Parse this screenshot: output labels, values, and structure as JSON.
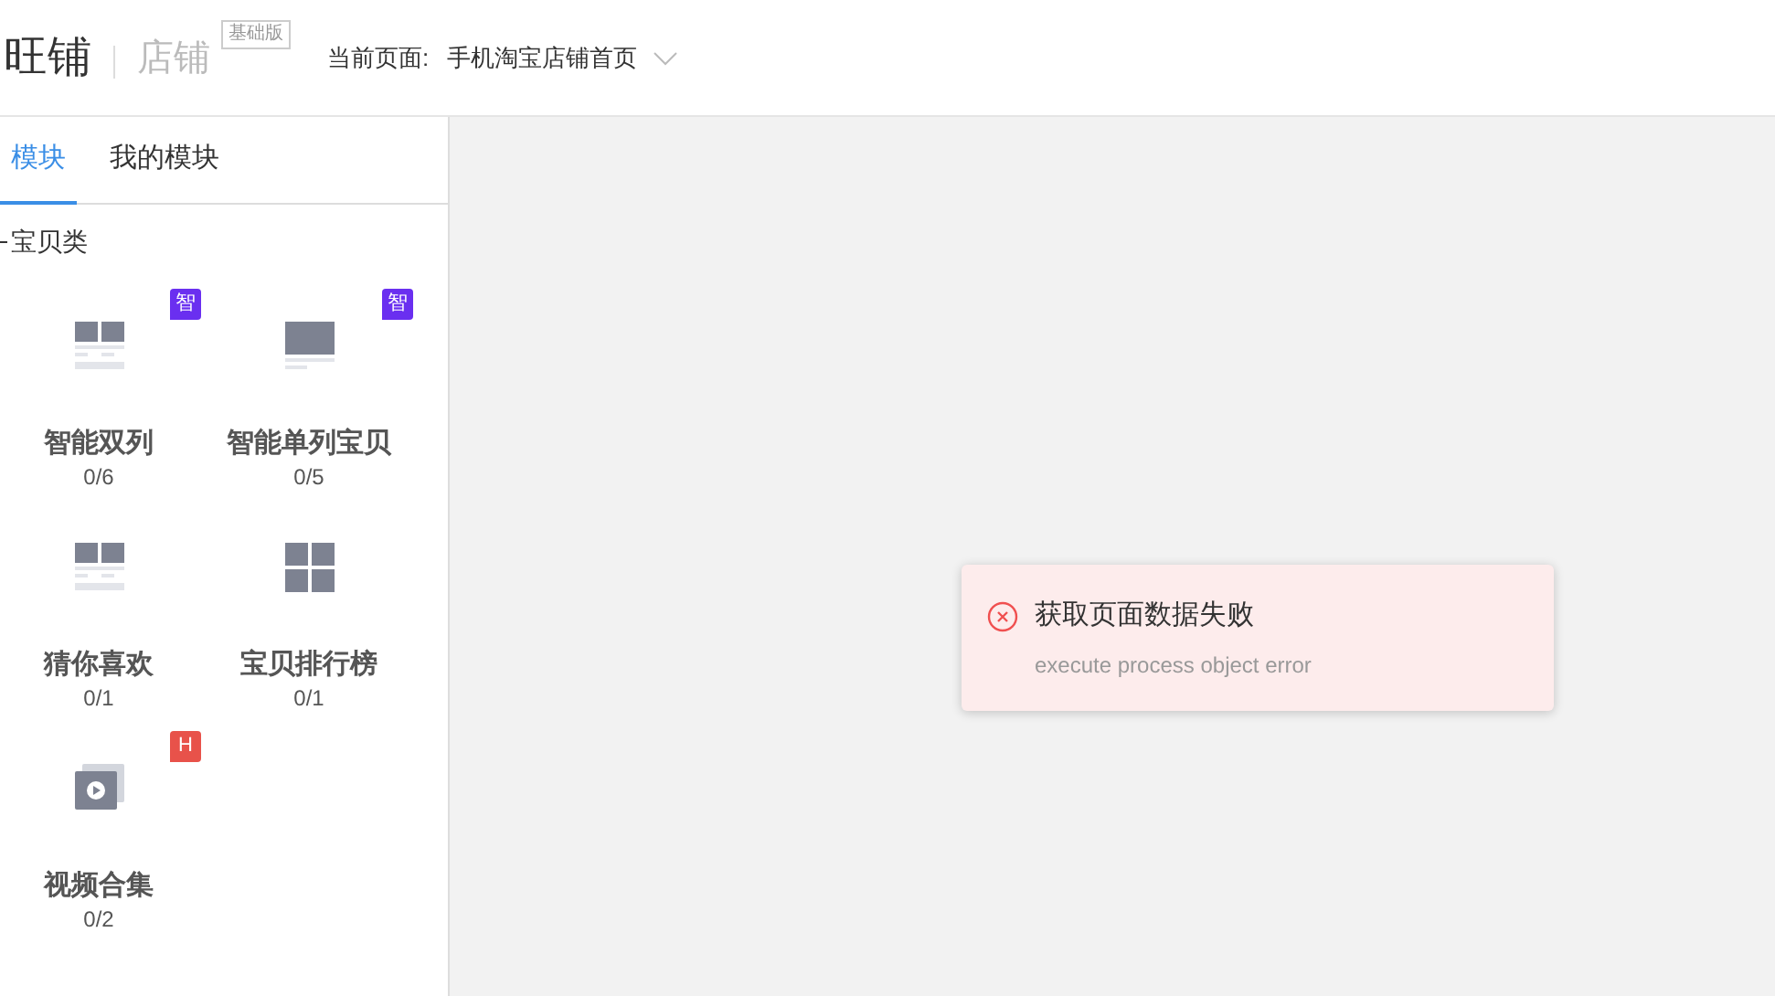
{
  "header": {
    "logo": "旺铺",
    "product": "店铺",
    "edition": "基础版",
    "current_page_label": "当前页面:",
    "current_page": "手机淘宝店铺首页"
  },
  "tabs": [
    {
      "label": "模块",
      "selected": true
    },
    {
      "label": "我的模块",
      "selected": false
    }
  ],
  "section": {
    "title": "宝贝类",
    "expanded": true
  },
  "modules": [
    {
      "name": "智能双列",
      "count": "0/6",
      "kind": "double",
      "badge": {
        "text": "智",
        "color": "#6a2ff0"
      }
    },
    {
      "name": "智能单列宝贝",
      "count": "0/5",
      "kind": "single",
      "badge": {
        "text": "智",
        "color": "#6a2ff0"
      }
    },
    {
      "name": "猜你喜欢",
      "count": "0/1",
      "kind": "double"
    },
    {
      "name": "宝贝排行榜",
      "count": "0/1",
      "kind": "grid"
    },
    {
      "name": "视频合集",
      "count": "0/2",
      "kind": "video",
      "badge": {
        "text": "H",
        "color": "#e8524a"
      }
    }
  ],
  "toast": {
    "title": "获取页面数据失败",
    "message": "execute process object error"
  }
}
